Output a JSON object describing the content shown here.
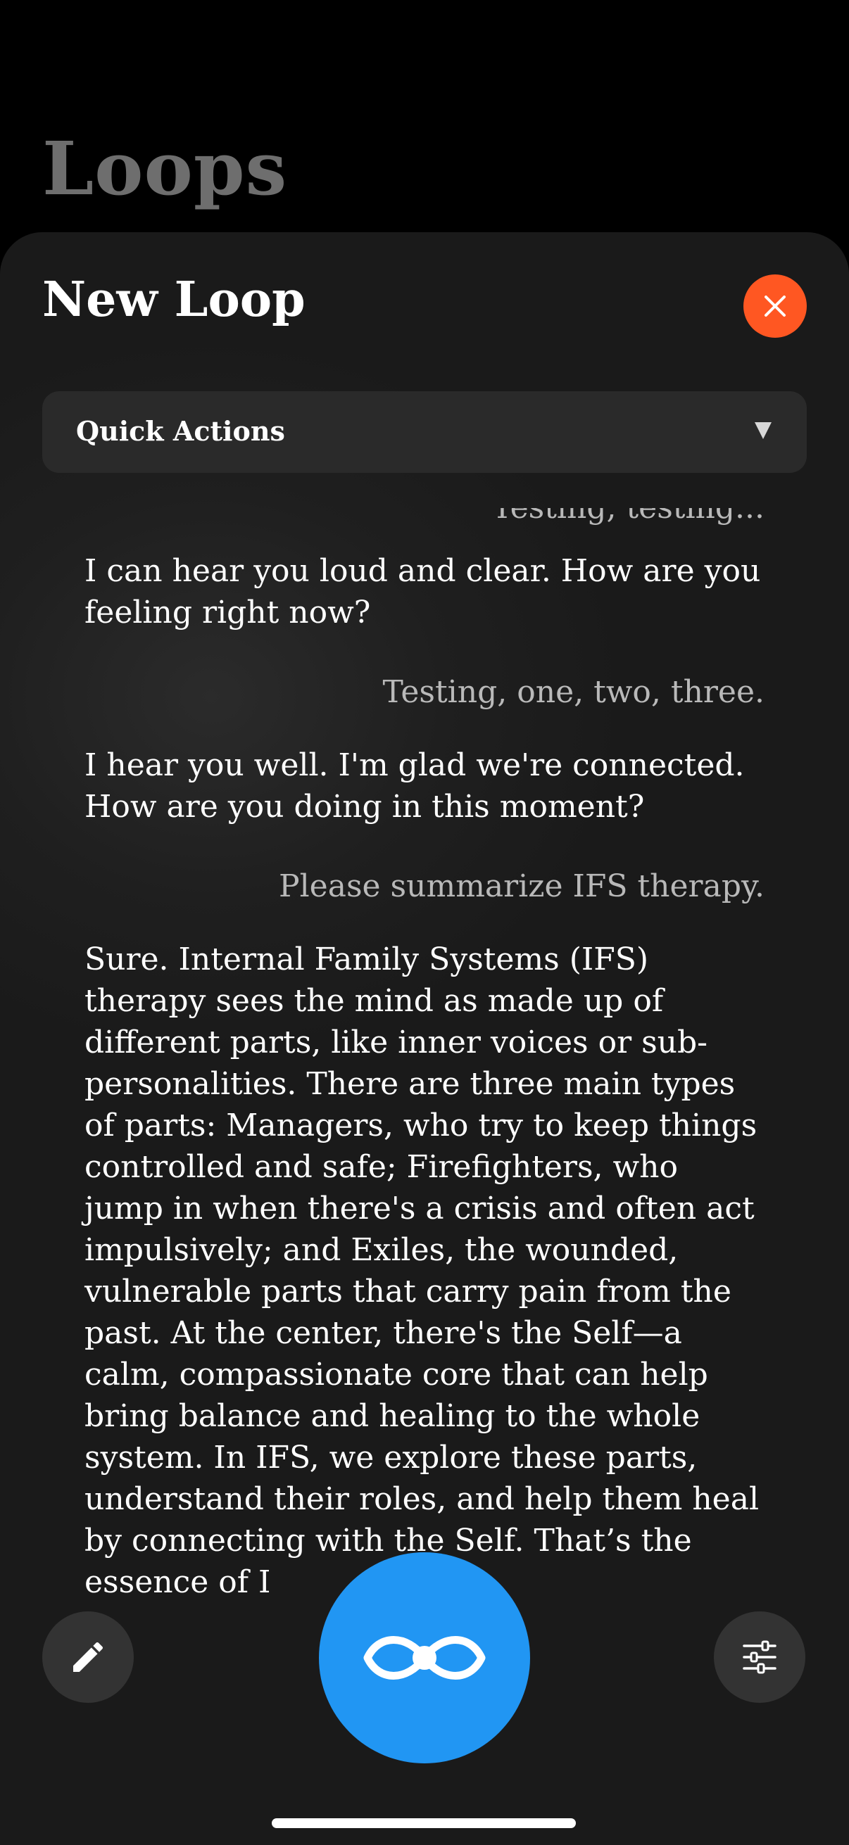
{
  "app": {
    "title": "Loops"
  },
  "sheet": {
    "title": "New Loop",
    "close_icon": "close-icon",
    "accent_color": "#ff5722"
  },
  "quick_actions": {
    "label": "Quick Actions",
    "icon": "triangle-down-icon"
  },
  "messages": [
    {
      "role": "user",
      "text": "Testing, testing..."
    },
    {
      "role": "assistant",
      "text": "I can hear you loud and clear. How are you feeling right now?"
    },
    {
      "role": "user",
      "text": "Testing, one, two, three."
    },
    {
      "role": "assistant",
      "text": "I hear you well. I'm glad we're connected. How are you doing in this moment?"
    },
    {
      "role": "user",
      "text": "Please summarize IFS therapy."
    },
    {
      "role": "assistant",
      "text": "Sure. Internal Family Systems (IFS) therapy sees the mind as made up of different parts, like inner voices or sub-personalities. There are three main types of parts: Managers, who try to keep things controlled and safe; Firefighters, who jump in when there's a crisis and often act impulsively; and Exiles, the wounded, vulnerable parts that carry pain from the past. At the center, there's the Self—a calm, compassionate core that can help bring balance and healing to the whole system. In IFS, we explore these parts, understand their roles, and help them heal by connecting with the Self. That’s the essence of I"
    }
  ],
  "toolbar": {
    "edit_icon": "pencil-icon",
    "main_icon": "infinity-loop-icon",
    "main_color": "#2196f3",
    "settings_icon": "sliders-icon"
  }
}
